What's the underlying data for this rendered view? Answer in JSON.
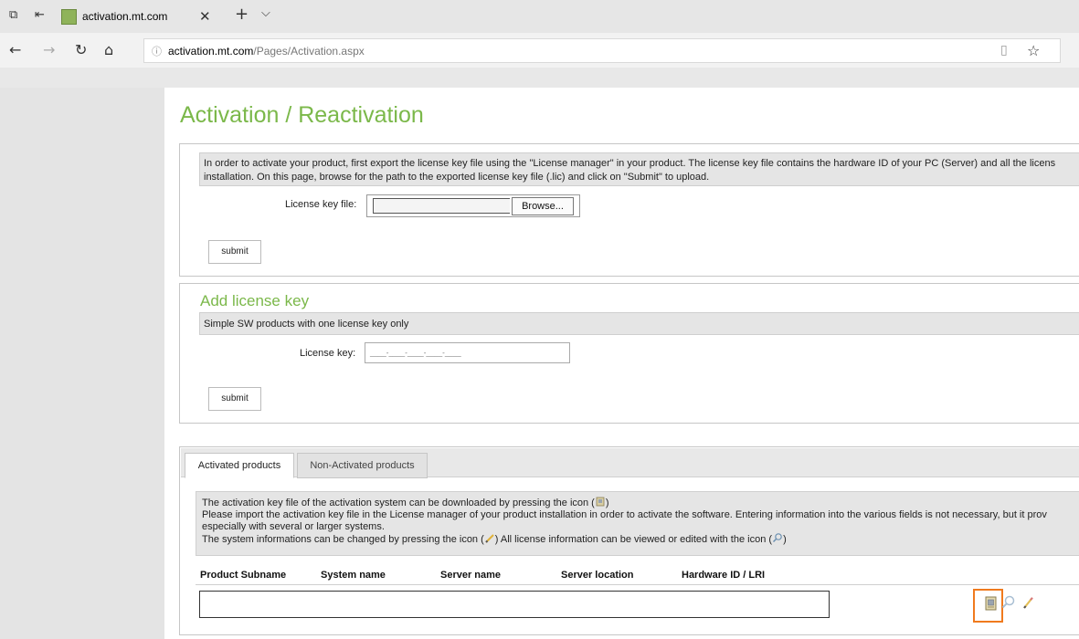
{
  "browser": {
    "tab_title": "activation.mt.com",
    "tab_close": "✕",
    "new_tab": "+",
    "tab_dropdown": "⌵",
    "url_host": "activation.mt.com",
    "url_path": "/Pages/Activation.aspx",
    "nav": {
      "back": "←",
      "forward": "→",
      "refresh": "↻",
      "home": "⌂",
      "info": "ⓘ",
      "favorite": "☆",
      "reading": "▯"
    }
  },
  "page": {
    "title": "Activation / Reactivation",
    "activation": {
      "info": "In order to activate your product, first export the license key file using the \"License manager\" in your product. The license key file contains the hardware ID of your PC (Server) and all the licens installation. On this page, browse for the path to the exported license key file (.lic) and click on \"Submit\" to upload.",
      "file_label": "License key file:",
      "browse_label": "Browse...",
      "submit_label": "submit"
    },
    "add_license": {
      "title": "Add license key",
      "info": "Simple SW products with one license key only",
      "key_label": "License key:",
      "key_placeholder": "____-____-____-____-____",
      "submit_label": "submit"
    },
    "products": {
      "tabs": [
        {
          "label": "Activated products",
          "active": true
        },
        {
          "label": "Non-Activated products",
          "active": false
        }
      ],
      "info_line1": "The activation key file of the activation system can be downloaded by pressing the icon (",
      "info_line1_end": ")",
      "info_line2": "Please import the activation key file in the License manager of your product installation in order to activate the software. Entering information into the various fields is not necessary, but it prov",
      "info_line3": "especially with several or larger systems.",
      "info_line4a": "The system informations can be changed by pressing the icon (",
      "info_line4b": ") All license information can be viewed or edited with the icon (",
      "info_line4c": ")",
      "columns": [
        "Product Subname",
        "System name",
        "Server name",
        "Server location",
        "Hardware ID / LRI"
      ],
      "row_icons": [
        "download-icon",
        "view-icon",
        "edit-icon"
      ]
    }
  },
  "colors": {
    "accent": "#7bb84a",
    "highlight": "#f07a1e"
  }
}
